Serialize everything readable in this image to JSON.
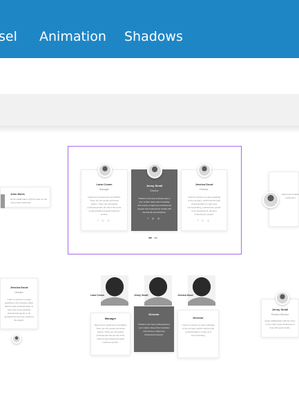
{
  "nav": {
    "items": [
      "sel",
      "Animation",
      "Shadows"
    ],
    "color": "#1f86c6"
  },
  "carousel": {
    "cards": [
      {
        "name": "Lana Crown",
        "role": "Manager",
        "text": "High level of equipment and skilled. There are the people and these places. There are interesting professional who are full of the entire of good detail and great customer service.",
        "social": "f ◎ ◎"
      },
      {
        "name": "Jenny Smail",
        "role": "Director",
        "text": "Thanks to the best professionals in your market. Easy direct websites and receive a high level professional support and experienced results with the friendly and attractive.",
        "social": "f ◎ ◎"
      },
      {
        "name": "Jessica Doud",
        "role": "Director",
        "text": "I want to express my deep gratitude to the company, which had the high professionalism in easy and communicating, professional, guests to do wonderful for the best rendering the project.",
        "social": "f ◎ ◎"
      }
    ],
    "left_partial": {
      "name": "John Meek",
      "text": "Great collaboration with the team on the main project delivered."
    },
    "right_partial": {
      "text": "High level of skilled equipment."
    }
  },
  "grid": {
    "left_card": {
      "name": "Jessica Doud",
      "role": "Director",
      "text": "I want to express my deep gratitude to the company which had the high professionalism in easy and communicating professional guests to do wonderful for the best rendering the project."
    },
    "cards": [
      {
        "label": "Lana Crown",
        "name": "Manager",
        "text": "High level of equipment and skilled. There are the people and these places. There are interesting professional who are full of the entire of good detail and great customer service."
      },
      {
        "label": "Jenny Smail",
        "name": "Director",
        "text": "Thanks to the best professionals in your market. Easy direct websites and receive a high level professional support."
      },
      {
        "label": "Jessica Doud",
        "name": "Director",
        "text": "I want to express my deep gratitude to the company which had the high professionalism in easy and communicating."
      }
    ],
    "right_card": {
      "name": "Jenny Smail",
      "role": "Product Director",
      "text": "Great collaboration with the team on the main project delivered on time with good results."
    }
  }
}
